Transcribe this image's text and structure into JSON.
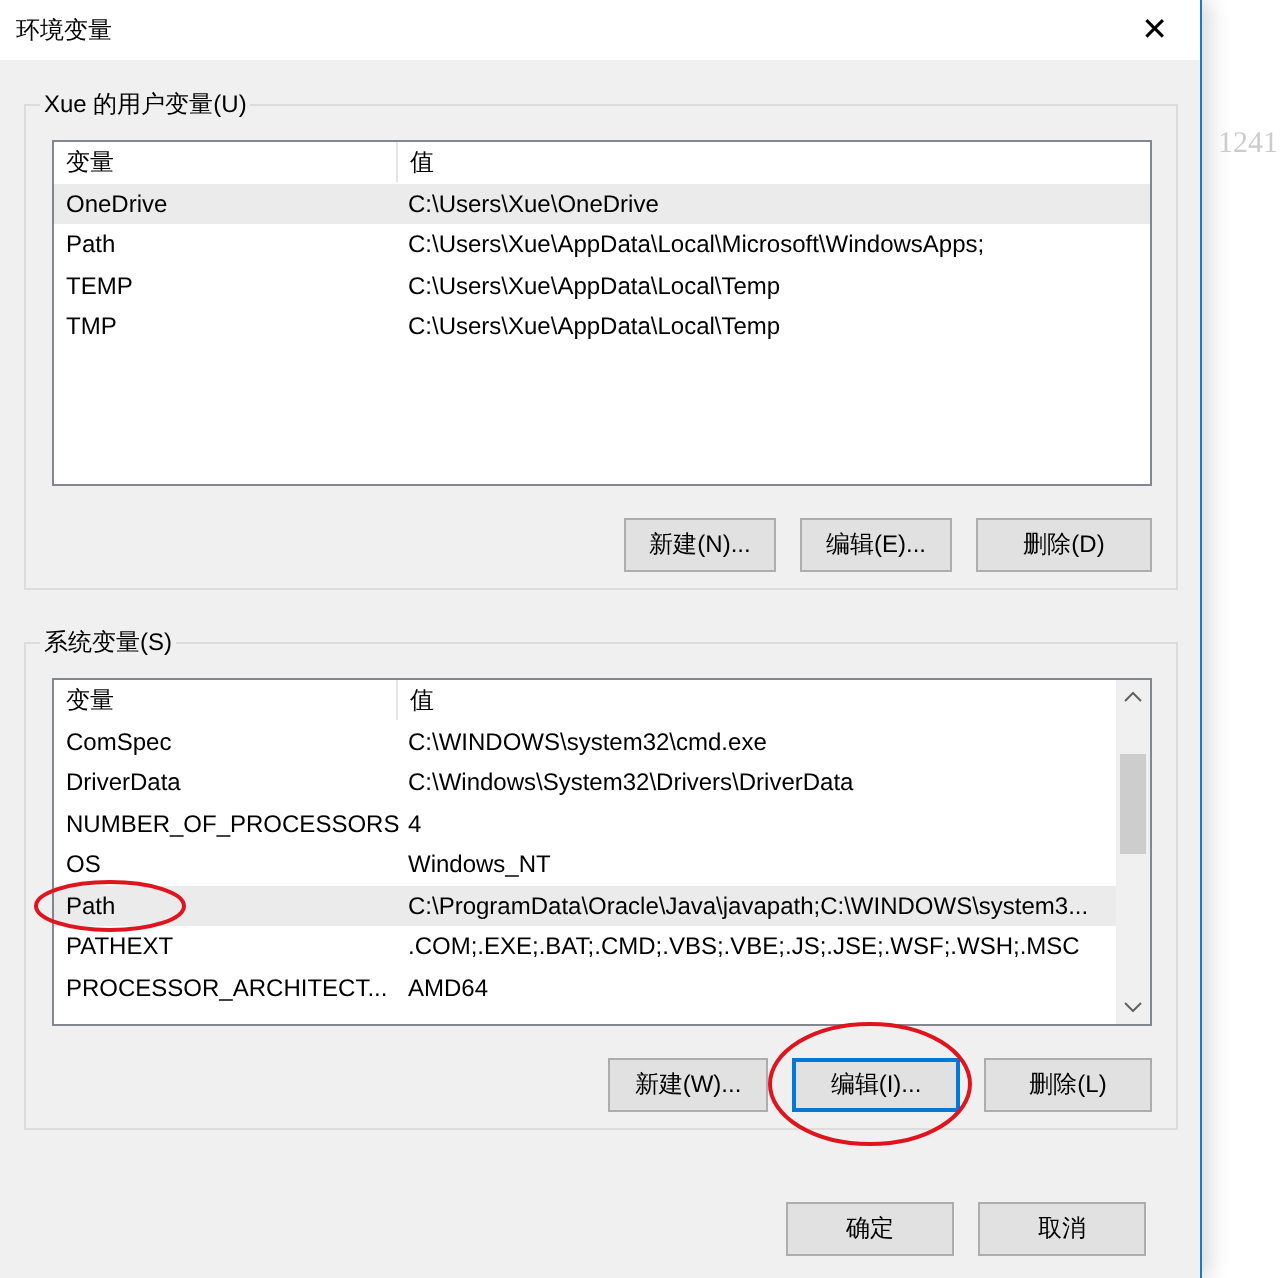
{
  "window": {
    "title": "环境变量",
    "close": "✕"
  },
  "background_text": "1241",
  "user_variables": {
    "title": "Xue 的用户变量(U)",
    "columns": [
      "变量",
      "值"
    ],
    "rows": [
      {
        "name": "OneDrive",
        "value": "C:\\Users\\Xue\\OneDrive",
        "selected": true,
        "circled": false
      },
      {
        "name": "Path",
        "value": "C:\\Users\\Xue\\AppData\\Local\\Microsoft\\WindowsApps;",
        "selected": false,
        "circled": false
      },
      {
        "name": "TEMP",
        "value": "C:\\Users\\Xue\\AppData\\Local\\Temp",
        "selected": false,
        "circled": false
      },
      {
        "name": "TMP",
        "value": "C:\\Users\\Xue\\AppData\\Local\\Temp",
        "selected": false,
        "circled": false
      }
    ],
    "buttons": [
      {
        "label": "新建(N)...",
        "focused": false,
        "circled": false
      },
      {
        "label": "编辑(E)...",
        "focused": false,
        "circled": false
      },
      {
        "label": "删除(D)",
        "focused": false,
        "circled": false
      }
    ]
  },
  "system_variables": {
    "title": "系统变量(S)",
    "columns": [
      "变量",
      "值"
    ],
    "rows": [
      {
        "name": "ComSpec",
        "value": "C:\\WINDOWS\\system32\\cmd.exe",
        "selected": false,
        "circled": false
      },
      {
        "name": "DriverData",
        "value": "C:\\Windows\\System32\\Drivers\\DriverData",
        "selected": false,
        "circled": false
      },
      {
        "name": "NUMBER_OF_PROCESSORS",
        "value": "4",
        "selected": false,
        "circled": false
      },
      {
        "name": "OS",
        "value": "Windows_NT",
        "selected": false,
        "circled": false
      },
      {
        "name": "Path",
        "value": "C:\\ProgramData\\Oracle\\Java\\javapath;C:\\WINDOWS\\system3...",
        "selected": true,
        "circled": true
      },
      {
        "name": "PATHEXT",
        "value": ".COM;.EXE;.BAT;.CMD;.VBS;.VBE;.JS;.JSE;.WSF;.WSH;.MSC",
        "selected": false,
        "circled": false
      },
      {
        "name": "PROCESSOR_ARCHITECT...",
        "value": "AMD64",
        "selected": false,
        "circled": false
      }
    ],
    "buttons": [
      {
        "label": "新建(W)...",
        "focused": false,
        "circled": false
      },
      {
        "label": "编辑(I)...",
        "focused": true,
        "circled": true
      },
      {
        "label": "删除(L)",
        "focused": false,
        "circled": false
      }
    ]
  },
  "footer_buttons": [
    {
      "label": "确定",
      "focused": false
    },
    {
      "label": "取消",
      "focused": false
    }
  ]
}
